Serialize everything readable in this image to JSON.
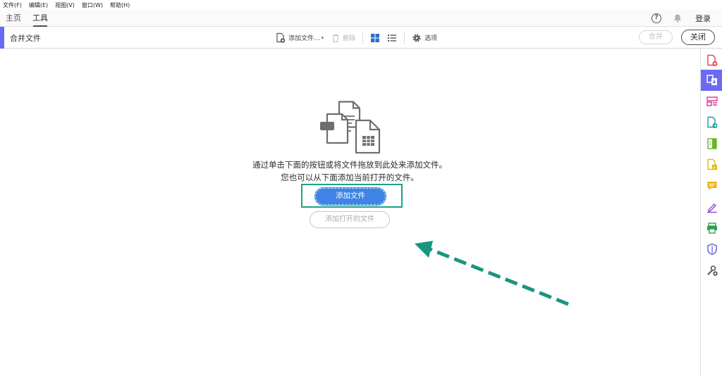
{
  "menubar": {
    "items": [
      "文件(F)",
      "编辑(E)",
      "视图(V)",
      "窗口(W)",
      "帮助(H)"
    ]
  },
  "tabs": {
    "home": "主页",
    "tools": "工具",
    "help_glyph": "?",
    "login": "登录"
  },
  "toolbar": {
    "title": "合并文件",
    "add_files": "添加文件...",
    "delete": "删除",
    "options": "选项",
    "merge": "合并",
    "close": "关闭"
  },
  "main": {
    "message_line1": "通过单击下面的按钮或将文件拖放到此处来添加文件。",
    "message_line2": "您也可以从下面添加当前打开的文件。",
    "add_files_button": "添加文件",
    "add_open_files_button": "添加打开的文件"
  },
  "colors": {
    "accent": "#6a6af4",
    "primary_button": "#3d84e6",
    "highlight": "#1aa38a"
  },
  "sidebar": {
    "icons": [
      "create-pdf-icon",
      "combine-files-icon",
      "organize-pages-icon",
      "export-pdf-icon",
      "compress-icon",
      "edit-pdf-icon",
      "comment-icon",
      "fill-sign-icon",
      "print-production-icon",
      "protect-icon",
      "more-tools-icon"
    ]
  }
}
